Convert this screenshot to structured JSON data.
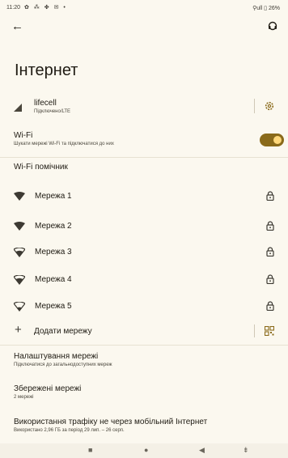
{
  "status": {
    "time": "11:20",
    "right": "⚲ull ▯ 26%"
  },
  "page": {
    "title": "Інтернет"
  },
  "carrier": {
    "name": "lifecell",
    "status": "Підключено/LTE"
  },
  "wifi": {
    "label": "Wi-Fi",
    "sub": "Шукати мережі Wi-Fi та підключатися до них",
    "enabled": true
  },
  "wifi_assistant": {
    "label": "Wi-Fi помічник"
  },
  "networks": [
    {
      "name": "Мережа 1",
      "secured": true
    },
    {
      "name": "Мережа 2",
      "secured": true
    },
    {
      "name": "Мережа 3",
      "secured": true
    },
    {
      "name": "Мережа 4",
      "secured": true
    },
    {
      "name": "Мережа 5",
      "secured": true
    }
  ],
  "add_network": {
    "label": "Додати мережу"
  },
  "settings": [
    {
      "label": "Налаштування мережі",
      "sub": "Підключатися до загальнодоступних мереж"
    },
    {
      "label": "Збережені мережі",
      "sub": "2 мережі"
    },
    {
      "label": "Використання трафіку не через мобільний Інтернет",
      "sub": "Використано 2,96 ГБ за період 29 лип. – 26 серп."
    }
  ],
  "colors": {
    "accent": "#8a6a1a",
    "background": "#fbf8ef"
  }
}
